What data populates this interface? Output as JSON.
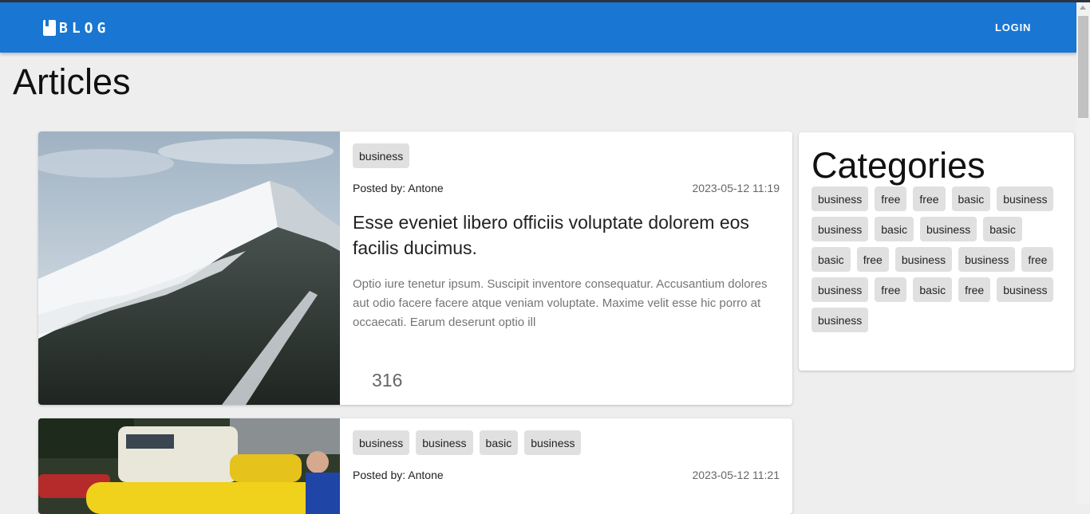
{
  "header": {
    "logo_text": "BLOG",
    "login_label": "LOGIN",
    "bar_color": "#1976d2"
  },
  "page": {
    "title": "Articles"
  },
  "articles": [
    {
      "tags": [
        "business"
      ],
      "posted_by": "Posted by: Antone",
      "date": "2023-05-12 11:19",
      "title": "Esse eveniet libero officiis voluptate dolorem eos facilis ducimus.",
      "excerpt": "Optio iure tenetur ipsum. Suscipit inventore consequatur. Accusantium dolores aut odio facere facere atque veniam voluptate. Maxime velit esse hic porro at occaecati. Earum deserunt optio ill",
      "views": "316",
      "image": "snowy-mountain-photo"
    },
    {
      "tags": [
        "business",
        "business",
        "basic",
        "business"
      ],
      "posted_by": "Posted by: Antone",
      "date": "2023-05-12 11:21",
      "image": "vintage-cars-photo"
    }
  ],
  "sidebar": {
    "title": "Categories",
    "categories": [
      "business",
      "free",
      "free",
      "basic",
      "business",
      "business",
      "basic",
      "business",
      "basic",
      "basic",
      "free",
      "business",
      "business",
      "free",
      "business",
      "free",
      "basic",
      "free",
      "business",
      "business"
    ]
  }
}
